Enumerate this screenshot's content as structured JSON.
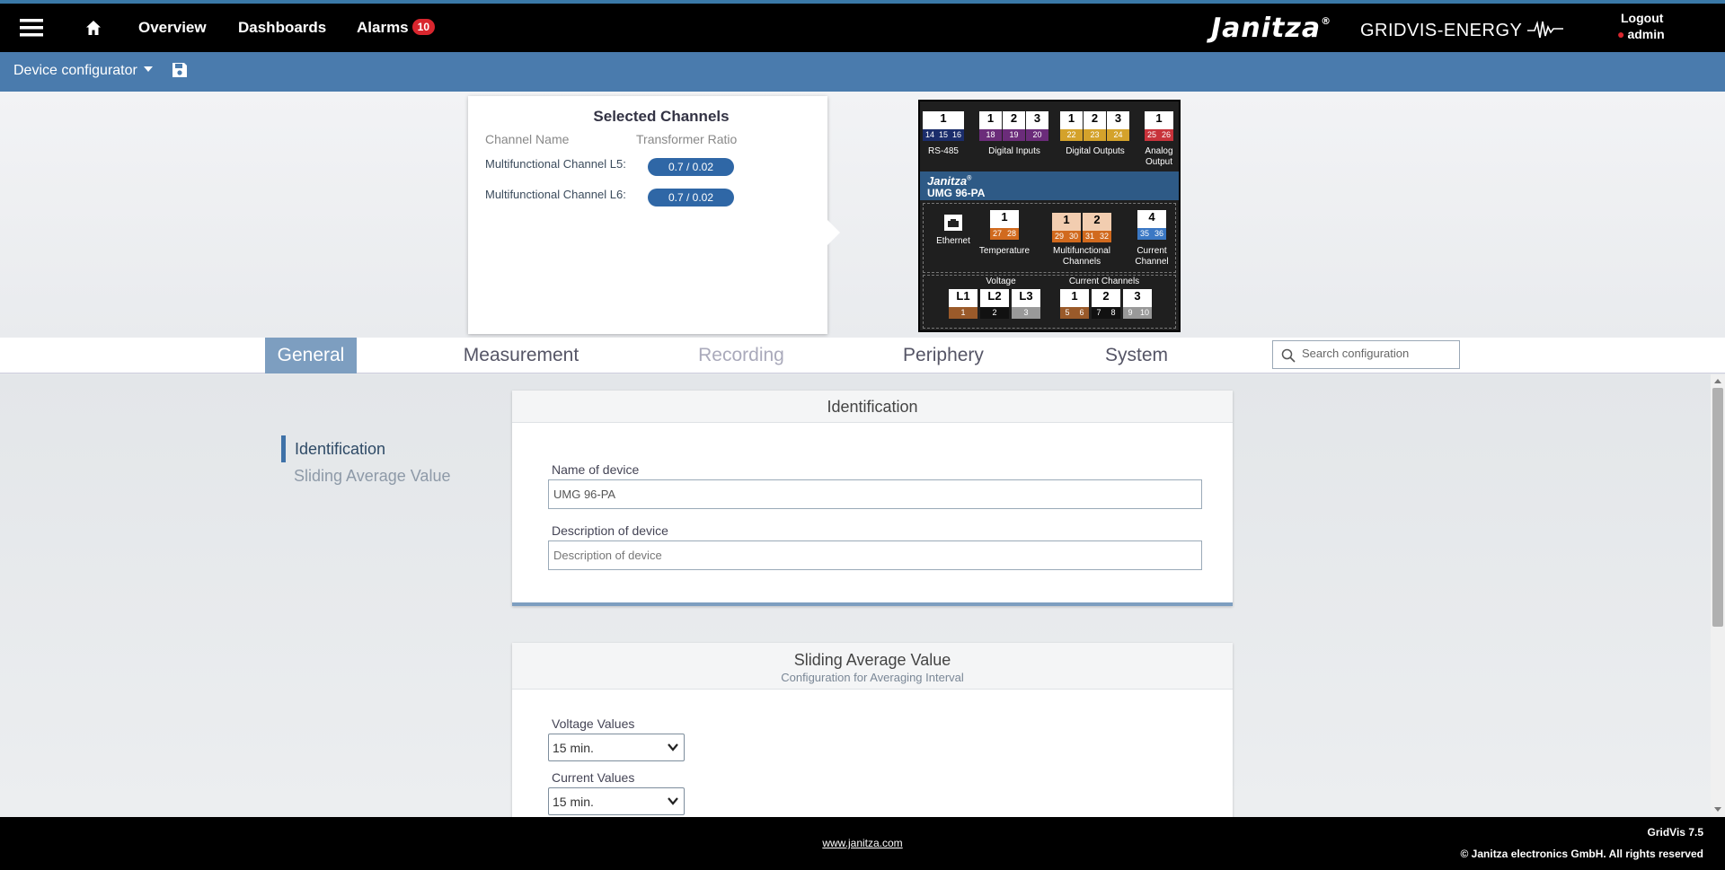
{
  "header": {
    "nav": {
      "overview": "Overview",
      "dashboards": "Dashboards",
      "alarms": "Alarms",
      "alarm_count": "10"
    },
    "brand": "Janitza",
    "brand_mark": "®",
    "product": "GRIDVIS-ENERGY",
    "logout": "Logout",
    "user": "admin"
  },
  "subbar": {
    "title": "Device configurator"
  },
  "selected_channels": {
    "title": "Selected Channels",
    "col_name": "Channel Name",
    "col_ratio": "Transformer Ratio",
    "rows": [
      {
        "name": "Multifunctional Channel L5:",
        "value": "0.7 / 0.02"
      },
      {
        "name": "Multifunctional Channel L6:",
        "value": "0.7 / 0.02"
      }
    ]
  },
  "device": {
    "brand": "Janitza",
    "brand_mark": "®",
    "model": "UMG 96-PA",
    "rs485": {
      "num": "1",
      "pins": [
        "14",
        "15",
        "16"
      ],
      "label": "RS-485"
    },
    "digital_inputs": {
      "nums": [
        "1",
        "2",
        "3"
      ],
      "pins": [
        "18",
        "19",
        "20"
      ],
      "label": "Digital Inputs"
    },
    "digital_outputs": {
      "nums": [
        "1",
        "2",
        "3"
      ],
      "pins": [
        "22",
        "23",
        "24"
      ],
      "label": "Digital Outputs"
    },
    "analog_output": {
      "num": "1",
      "pins": [
        "25",
        "26"
      ],
      "label": "Analog Output"
    },
    "ethernet": {
      "label": "Ethernet"
    },
    "temperature": {
      "num": "1",
      "pins": [
        "27",
        "28"
      ],
      "label": "Temperature"
    },
    "multifunctional": {
      "nums": [
        "1",
        "2"
      ],
      "pins": [
        "29",
        "30",
        "31",
        "32"
      ],
      "label": "Multifunctional Channels"
    },
    "current_channel": {
      "num": "4",
      "pins": [
        "35",
        "36"
      ],
      "label": "Current Channel"
    },
    "voltage": {
      "title": "Voltage",
      "nums": [
        "L1",
        "L2",
        "L3"
      ],
      "pins": [
        "1",
        "2",
        "3"
      ]
    },
    "current_channels": {
      "title": "Current Channels",
      "nums": [
        "1",
        "2",
        "3"
      ],
      "pins": [
        "5",
        "6",
        "7",
        "8",
        "9",
        "10"
      ]
    }
  },
  "tabs": [
    "General",
    "Measurement",
    "Recording",
    "Periphery",
    "System"
  ],
  "search": {
    "placeholder": "Search configuration"
  },
  "sidenav": [
    "Identification",
    "Sliding Average Value"
  ],
  "identification": {
    "title": "Identification",
    "name_label": "Name of device",
    "name_value": "UMG 96-PA",
    "desc_label": "Description of device",
    "desc_placeholder": "Description of device"
  },
  "sliding": {
    "title": "Sliding Average Value",
    "subtitle": "Configuration for Averaging Interval",
    "voltage_label": "Voltage Values",
    "voltage_value": "15 min.",
    "current_label": "Current Values",
    "current_value": "15 min."
  },
  "footer": {
    "link": "www.janitza.com",
    "version": "GridVis 7.5",
    "copyright": "© Janitza electronics GmbH. All rights reserved"
  },
  "colors": {
    "accent": "#4a7bad",
    "active_tab": "#7d9ec0",
    "alarm": "#d9262e"
  }
}
